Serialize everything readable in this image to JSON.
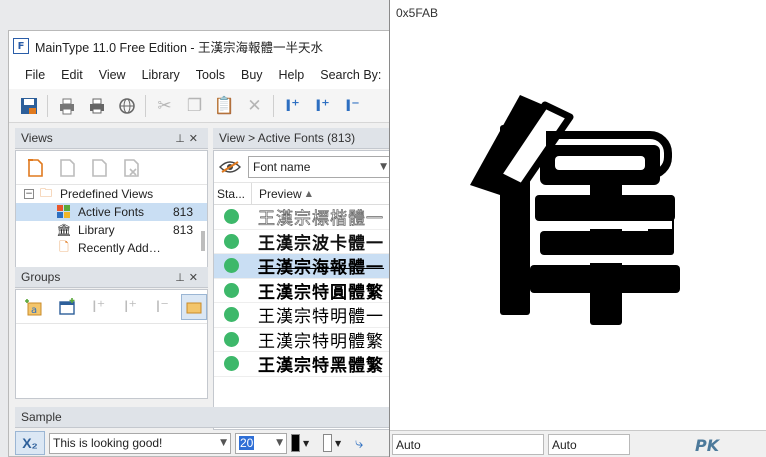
{
  "window": {
    "title": "MainType 11.0 Free Edition - 王漢宗海報體一半天水",
    "logo_icon": "maintype-logo-icon"
  },
  "menu": [
    "File",
    "Edit",
    "View",
    "Library",
    "Tools",
    "Buy",
    "Help",
    "Search By:"
  ],
  "toolbar_icons": [
    "save-icon",
    "print-preview-icon",
    "print-icon",
    "web-icon",
    "cut-icon",
    "copy-icon",
    "paste-icon",
    "delete-icon",
    "add-font-icon",
    "add-font-plus-icon",
    "remove-font-icon"
  ],
  "views": {
    "title": "Views",
    "items": [
      {
        "label": "Predefined Views",
        "count": "",
        "icon": "folder-icon"
      },
      {
        "label": "Active Fonts",
        "count": "813",
        "icon": "windows-fonts-icon"
      },
      {
        "label": "Library",
        "count": "813",
        "icon": "library-icon"
      },
      {
        "label": "Recently Add…",
        "count": "",
        "icon": "recent-icon"
      }
    ]
  },
  "groups": {
    "title": "Groups"
  },
  "fonts": {
    "breadcrumb": "View > Active Fonts (813)",
    "filter_field": "Font name",
    "col_status": "Sta...",
    "col_preview": "Preview",
    "rows": [
      {
        "preview": "王漢宗標楷體一",
        "style": "outline",
        "selected": false
      },
      {
        "preview": "王漢宗波卡體一",
        "style": "pop",
        "selected": false
      },
      {
        "preview": "王漢宗海報體一",
        "style": "poster",
        "selected": true
      },
      {
        "preview": "王漢宗特圓體繁",
        "style": "round",
        "selected": false
      },
      {
        "preview": "王漢宗特明體一",
        "style": "ming",
        "selected": false
      },
      {
        "preview": "王漢宗特明體繁",
        "style": "ming",
        "selected": false
      },
      {
        "preview": "王漢宗特黑體繁",
        "style": "hei",
        "selected": false
      }
    ],
    "status_color": "#3db86a"
  },
  "sample": {
    "title": "Sample",
    "subscript_label": "X₂",
    "text": "This is looking good!",
    "size": "20",
    "color": "#000000",
    "bg_color": "#ffffff"
  },
  "glyph_view": {
    "code": "0x5FAB",
    "character": "偉",
    "footer_left": "Auto",
    "footer_right": "Auto",
    "watermark": "PK"
  },
  "colors": {
    "selection": "#c9def3",
    "accent": "#2d6fc1"
  }
}
